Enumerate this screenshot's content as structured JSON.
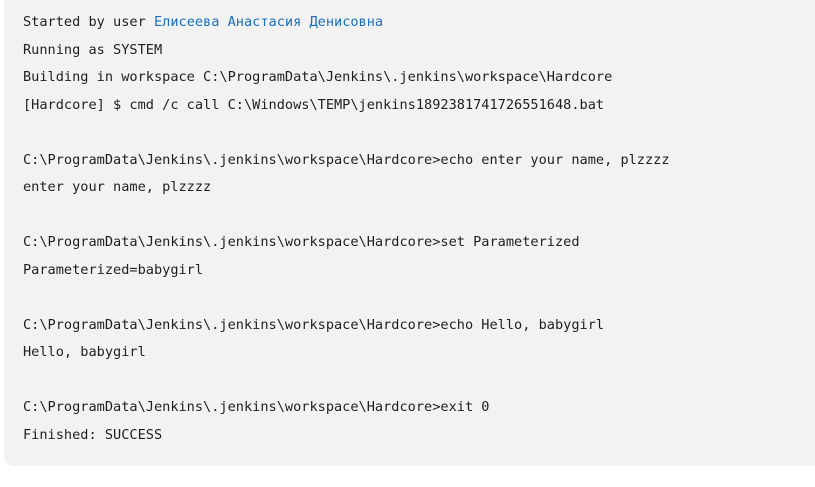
{
  "console": {
    "started_prefix": "Started by user ",
    "user_name": "Елисеева Анастасия Денисовна",
    "lines": [
      "Running as SYSTEM",
      "Building in workspace C:\\ProgramData\\Jenkins\\.jenkins\\workspace\\Hardcore",
      "[Hardcore] $ cmd /c call C:\\Windows\\TEMP\\jenkins1892381741726551648.bat",
      "",
      "C:\\ProgramData\\Jenkins\\.jenkins\\workspace\\Hardcore>echo enter your name, plzzzz",
      "enter your name, plzzzz",
      "",
      "C:\\ProgramData\\Jenkins\\.jenkins\\workspace\\Hardcore>set Parameterized",
      "Parameterized=babygirl",
      "",
      "C:\\ProgramData\\Jenkins\\.jenkins\\workspace\\Hardcore>echo Hello, babygirl",
      "Hello, babygirl",
      "",
      "C:\\ProgramData\\Jenkins\\.jenkins\\workspace\\Hardcore>exit 0",
      "Finished: SUCCESS"
    ]
  },
  "colors": {
    "background": "#f2f2f2",
    "text": "#1f1f1f",
    "link": "#1a6fc2"
  }
}
